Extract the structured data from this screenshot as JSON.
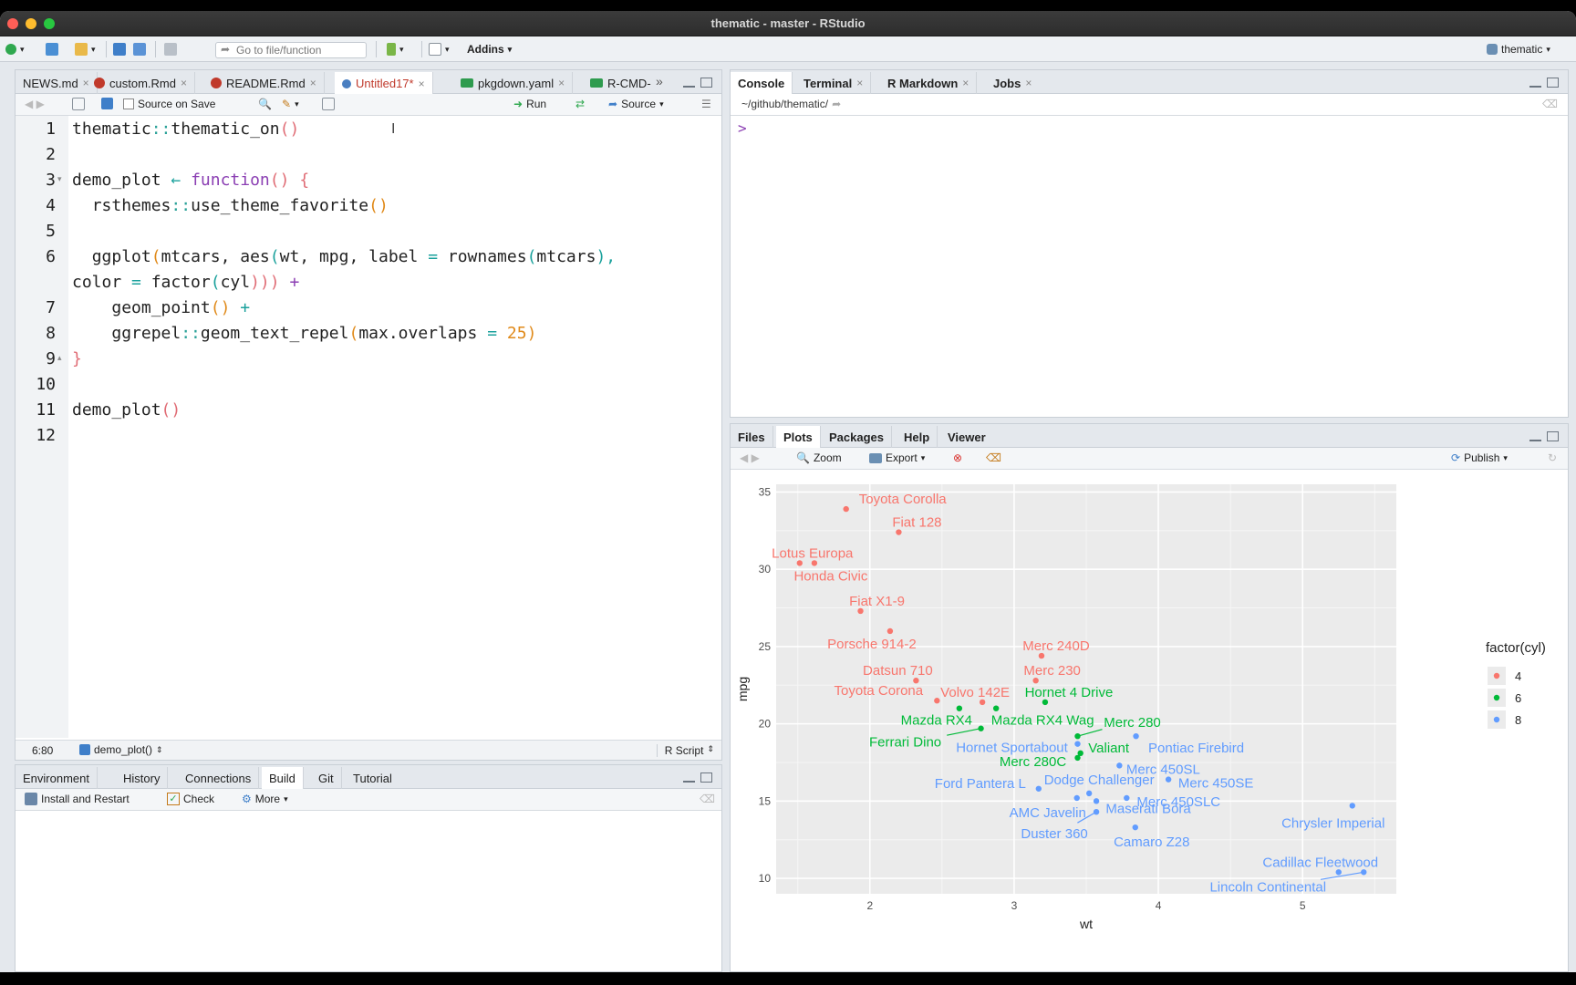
{
  "window": {
    "title": "thematic - master - RStudio"
  },
  "toolbar": {
    "goto_placeholder": "Go to file/function",
    "addins_label": "Addins",
    "project_label": "thematic"
  },
  "editor": {
    "tabs": [
      {
        "label": "NEWS.md"
      },
      {
        "label": "custom.Rmd"
      },
      {
        "label": "README.Rmd"
      },
      {
        "label": "Untitled17*"
      },
      {
        "label": "pkgdown.yaml"
      },
      {
        "label": "R-CMD-"
      }
    ],
    "source_on_save_label": "Source on Save",
    "run_label": "Run",
    "source_label": "Source",
    "line_numbers": [
      "1",
      "2",
      "3",
      "4",
      "5",
      "6",
      "",
      "7",
      "8",
      "9",
      "10",
      "11",
      "12"
    ],
    "status": {
      "position": "6:80",
      "function": "demo_plot()",
      "filetype": "R Script"
    }
  },
  "code": {
    "l1_ns": "thematic",
    "l1_sep": "::",
    "l1_fn": "thematic_on",
    "l1_par": "()",
    "l3_name": "demo_plot",
    "l3_arrow": "←",
    "l3_kw": "function",
    "l3_par": "()",
    "l3_brace": "{",
    "l4_ns": "rsthemes",
    "l4_sep": "::",
    "l4_fn": "use_theme_favorite",
    "l4_par": "()",
    "l6_a": "ggplot",
    "l6_p1": "(",
    "l6_b": "mtcars, aes",
    "l6_p2": "(",
    "l6_c": "wt, mpg, label ",
    "l6_eq": "=",
    "l6_d": " rownames",
    "l6_p3": "(",
    "l6_e": "mtcars",
    "l6_p4": "),",
    "l6w_a": "color ",
    "l6w_eq": "=",
    "l6w_b": " factor",
    "l6w_p1": "(",
    "l6w_c": "cyl",
    "l6w_p2": ")))",
    "l6w_plus": " +",
    "l7_fn": "geom_point",
    "l7_par": "()",
    "l7_plus": " +",
    "l8_ns": "ggrepel",
    "l8_sep": "::",
    "l8_fn": "geom_text_repel",
    "l8_p1": "(",
    "l8_arg": "max.overlaps ",
    "l8_eq": "=",
    "l8_num": " 25",
    "l8_p2": ")",
    "l9_brace": "}",
    "l11_fn": "demo_plot",
    "l11_par": "()"
  },
  "console": {
    "tabs": [
      {
        "label": "Console"
      },
      {
        "label": "Terminal"
      },
      {
        "label": "R Markdown"
      },
      {
        "label": "Jobs"
      }
    ],
    "path": "~/github/thematic/",
    "prompt": ">"
  },
  "build": {
    "tabs": [
      {
        "label": "Environment"
      },
      {
        "label": "History"
      },
      {
        "label": "Connections"
      },
      {
        "label": "Build"
      },
      {
        "label": "Git"
      },
      {
        "label": "Tutorial"
      }
    ],
    "install_label": "Install and Restart",
    "check_label": "Check",
    "more_label": "More"
  },
  "plots": {
    "tabs": [
      {
        "label": "Files"
      },
      {
        "label": "Plots"
      },
      {
        "label": "Packages"
      },
      {
        "label": "Help"
      },
      {
        "label": "Viewer"
      }
    ],
    "zoom_label": "Zoom",
    "export_label": "Export",
    "publish_label": "Publish"
  },
  "colors": {
    "cyl4": "#f8766d",
    "cyl6": "#00ba38",
    "cyl8": "#619cff",
    "panel": "#ebebeb"
  },
  "chart_data": {
    "type": "scatter",
    "xlabel": "wt",
    "ylabel": "mpg",
    "xlim": [
      1.35,
      5.65
    ],
    "ylim": [
      9.0,
      35.5
    ],
    "xticks": [
      2,
      3,
      4,
      5
    ],
    "yticks": [
      10,
      15,
      20,
      25,
      30,
      35
    ],
    "grid": true,
    "legend": {
      "title": "factor(cyl)",
      "placement": "right",
      "entries": [
        "4",
        "6",
        "8"
      ]
    },
    "series": [
      {
        "name": "4",
        "color": "#f8766d",
        "points": [
          {
            "label": "Datsun 710",
            "x": 2.32,
            "y": 22.8
          },
          {
            "label": "Merc 240D",
            "x": 3.19,
            "y": 24.4
          },
          {
            "label": "Merc 230",
            "x": 3.15,
            "y": 22.8
          },
          {
            "label": "Fiat 128",
            "x": 2.2,
            "y": 32.4
          },
          {
            "label": "Honda Civic",
            "x": 1.615,
            "y": 30.4
          },
          {
            "label": "Toyota Corolla",
            "x": 1.835,
            "y": 33.9
          },
          {
            "label": "Toyota Corona",
            "x": 2.465,
            "y": 21.5
          },
          {
            "label": "Fiat X1-9",
            "x": 1.935,
            "y": 27.3
          },
          {
            "label": "Porsche 914-2",
            "x": 2.14,
            "y": 26.0
          },
          {
            "label": "Lotus Europa",
            "x": 1.513,
            "y": 30.4
          },
          {
            "label": "Volvo 142E",
            "x": 2.78,
            "y": 21.4
          }
        ]
      },
      {
        "name": "6",
        "color": "#00ba38",
        "points": [
          {
            "label": "Mazda RX4",
            "x": 2.62,
            "y": 21.0
          },
          {
            "label": "Mazda RX4 Wag",
            "x": 2.875,
            "y": 21.0
          },
          {
            "label": "Hornet 4 Drive",
            "x": 3.215,
            "y": 21.4
          },
          {
            "label": "Valiant",
            "x": 3.46,
            "y": 18.1
          },
          {
            "label": "Merc 280",
            "x": 3.44,
            "y": 19.2
          },
          {
            "label": "Merc 280C",
            "x": 3.44,
            "y": 17.8
          },
          {
            "label": "Ferrari Dino",
            "x": 2.77,
            "y": 19.7
          }
        ]
      },
      {
        "name": "8",
        "color": "#619cff",
        "points": [
          {
            "label": "Hornet Sportabout",
            "x": 3.44,
            "y": 18.7
          },
          {
            "label": "Duster 360",
            "x": 3.57,
            "y": 14.3
          },
          {
            "label": "Merc 450SE",
            "x": 4.07,
            "y": 16.4
          },
          {
            "label": "Merc 450SL",
            "x": 3.73,
            "y": 17.3
          },
          {
            "label": "Merc 450SLC",
            "x": 3.78,
            "y": 15.2
          },
          {
            "label": "Cadillac Fleetwood",
            "x": 5.25,
            "y": 10.4
          },
          {
            "label": "Lincoln Continental",
            "x": 5.424,
            "y": 10.4
          },
          {
            "label": "Chrysler Imperial",
            "x": 5.345,
            "y": 14.7
          },
          {
            "label": "Dodge Challenger",
            "x": 3.52,
            "y": 15.5
          },
          {
            "label": "AMC Javelin",
            "x": 3.435,
            "y": 15.2
          },
          {
            "label": "Camaro Z28",
            "x": 3.84,
            "y": 13.3
          },
          {
            "label": "Pontiac Firebird",
            "x": 3.845,
            "y": 19.2
          },
          {
            "label": "Ford Pantera L",
            "x": 3.17,
            "y": 15.8
          },
          {
            "label": "Maserati Bora",
            "x": 3.57,
            "y": 15.0
          }
        ]
      }
    ]
  }
}
